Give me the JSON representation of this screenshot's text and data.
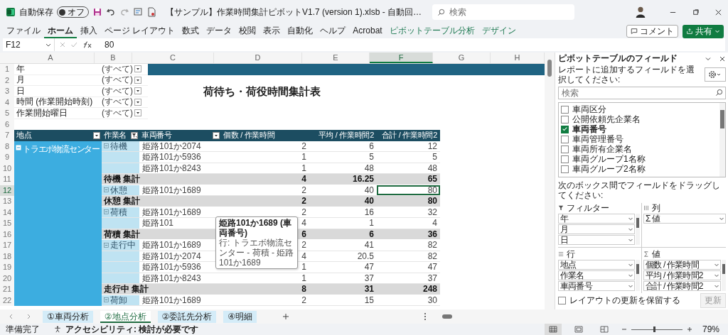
{
  "title_bar": {
    "autosave_label": "自動保存",
    "autosave": {
      "label": "オフ",
      "on": false
    },
    "file_name": "【サンプル】作業時間集計ピボットV1.7 (version 1).xlsb - 自動回…",
    "search": {
      "placeholder": "検索"
    }
  },
  "ribbon_tabs": [
    {
      "label": "ファイル",
      "selected": false,
      "kind": "normal"
    },
    {
      "label": "ホーム",
      "selected": true,
      "kind": "normal"
    },
    {
      "label": "挿入",
      "selected": false,
      "kind": "normal"
    },
    {
      "label": "ページ レイアウト",
      "selected": false,
      "kind": "normal"
    },
    {
      "label": "数式",
      "selected": false,
      "kind": "normal"
    },
    {
      "label": "データ",
      "selected": false,
      "kind": "normal"
    },
    {
      "label": "校閲",
      "selected": false,
      "kind": "normal"
    },
    {
      "label": "表示",
      "selected": false,
      "kind": "normal"
    },
    {
      "label": "自動化",
      "selected": false,
      "kind": "normal"
    },
    {
      "label": "ヘルプ",
      "selected": false,
      "kind": "normal"
    },
    {
      "label": "Acrobat",
      "selected": false,
      "kind": "normal"
    },
    {
      "label": "ピボットテーブル分析",
      "selected": false,
      "kind": "contextual"
    },
    {
      "label": "デザイン",
      "selected": false,
      "kind": "contextual"
    }
  ],
  "ribbon_buttons": {
    "comment": "コメント",
    "share": "共有"
  },
  "formula_bar": {
    "name_box": "F12",
    "value": "80"
  },
  "column_headers": [
    {
      "label": "A",
      "selected": false
    },
    {
      "label": "B",
      "selected": false
    },
    {
      "label": "C",
      "selected": false
    },
    {
      "label": "D",
      "selected": false
    },
    {
      "label": "E",
      "selected": false
    },
    {
      "label": "F",
      "selected": true
    },
    {
      "label": "G",
      "selected": false
    },
    {
      "label": "H",
      "selected": false
    }
  ],
  "row_numbers": [
    {
      "label": "1",
      "selected": false
    },
    {
      "label": "2",
      "selected": false
    },
    {
      "label": "3",
      "selected": false
    },
    {
      "label": "4",
      "selected": false
    },
    {
      "label": "5",
      "selected": false
    },
    {
      "label": "6",
      "selected": false
    },
    {
      "label": "7",
      "selected": false
    },
    {
      "label": "8",
      "selected": false
    },
    {
      "label": "9",
      "selected": false
    },
    {
      "label": "10",
      "selected": false
    },
    {
      "label": "11",
      "selected": false
    },
    {
      "label": "12",
      "selected": true
    },
    {
      "label": "13",
      "selected": false
    },
    {
      "label": "14",
      "selected": false
    },
    {
      "label": "15",
      "selected": false
    },
    {
      "label": "16",
      "selected": false
    },
    {
      "label": "17",
      "selected": false
    },
    {
      "label": "18",
      "selected": false
    },
    {
      "label": "19",
      "selected": false
    },
    {
      "label": "20",
      "selected": false
    },
    {
      "label": "21",
      "selected": false
    },
    {
      "label": "22",
      "selected": false
    }
  ],
  "filters": [
    {
      "label": "年",
      "value": "(すべて)"
    },
    {
      "label": "月",
      "value": "(すべて)"
    },
    {
      "label": "日",
      "value": "(すべて)"
    },
    {
      "label": "時間 (作業開始時刻)",
      "value": "(すべて)"
    },
    {
      "label": "作業開始曜日",
      "value": "(すべて)"
    }
  ],
  "report_title": "荷待ち・荷役時間集計表",
  "pivot": {
    "headers": [
      {
        "label": "地点",
        "kind": "field_dropdown"
      },
      {
        "label": "作業名",
        "kind": "field_filter"
      },
      {
        "label": "車両番号",
        "kind": "field_dropdown"
      },
      {
        "label": "個数 / 作業時間",
        "kind": "value"
      },
      {
        "label": "平均 / 作業時間2",
        "kind": "value"
      },
      {
        "label": "合計 / 作業時間2",
        "kind": "value"
      }
    ],
    "location": "トラエボ物流センター",
    "rows": [
      {
        "kind": "data",
        "task": "待機",
        "vehicle": "姫路101か2074",
        "count": "2",
        "avg": "6",
        "sum": "12",
        "selected": false
      },
      {
        "kind": "data",
        "vehicle": "姫路101か5936",
        "count": "1",
        "avg": "5",
        "sum": "5",
        "selected": false
      },
      {
        "kind": "data",
        "vehicle": "姫路101か8243",
        "count": "1",
        "avg": "48",
        "sum": "48",
        "selected": false
      },
      {
        "kind": "subtotal",
        "label": "待機 集計",
        "count": "4",
        "avg": "16.25",
        "sum": "65",
        "selected": false
      },
      {
        "kind": "data",
        "task": "休憩",
        "vehicle": "姫路101か1689",
        "count": "2",
        "avg": "40",
        "sum": "80",
        "selected": true
      },
      {
        "kind": "subtotal",
        "label": "休憩 集計",
        "count": "2",
        "avg": "40",
        "sum": "80",
        "selected": false
      },
      {
        "kind": "data",
        "task": "荷積",
        "vehicle": "姫路101か1689",
        "count": "2",
        "avg": "16",
        "sum": "32",
        "selected": false
      },
      {
        "kind": "data",
        "vehicle": "姫路101",
        "count": "4",
        "avg": "1",
        "sum": "4",
        "selected": false
      },
      {
        "kind": "subtotal",
        "label": "荷積 集計",
        "count": "6",
        "avg": "6",
        "sum": "36",
        "selected": false
      },
      {
        "kind": "data",
        "task": "走行中",
        "vehicle": "姫路101か1689",
        "count": "2",
        "avg": "41",
        "sum": "82",
        "selected": false
      },
      {
        "kind": "data",
        "vehicle": "姫路101か2074",
        "count": "4",
        "avg": "20.5",
        "sum": "82",
        "selected": false
      },
      {
        "kind": "data",
        "vehicle": "姫路101か5936",
        "count": "1",
        "avg": "47",
        "sum": "47",
        "selected": false
      },
      {
        "kind": "data",
        "vehicle": "姫路101か8243",
        "count": "1",
        "avg": "37",
        "sum": "37",
        "selected": false
      },
      {
        "kind": "subtotal",
        "label": "走行中 集計",
        "count": "8",
        "avg": "31",
        "sum": "248",
        "selected": false
      },
      {
        "kind": "data",
        "task": "荷卸",
        "vehicle": "姫路101か1689",
        "count": "2",
        "avg": "15",
        "sum": "30",
        "selected": false
      }
    ]
  },
  "tooltip": {
    "title": "姫路101か1689 (車両番号)",
    "detail": "行: トラエボ物流センター - 荷積 - 姫路101か1689"
  },
  "sheet_tabs": [
    {
      "label": "①車両分析",
      "selected": false
    },
    {
      "label": "②地点分析",
      "selected": true
    },
    {
      "label": "②委託先分析",
      "selected": false
    },
    {
      "label": "④明細",
      "selected": false
    }
  ],
  "field_panel": {
    "title": "ピボットテーブルのフィールド",
    "subtitle": "レポートに追加するフィールドを選択してください:",
    "search": {
      "placeholder": "検索"
    },
    "fields": [
      {
        "label": "車両区分",
        "checked": false
      },
      {
        "label": "公開依頼先企業名",
        "checked": false
      },
      {
        "label": "車両番号",
        "checked": true
      },
      {
        "label": "車両管理番号",
        "checked": false
      },
      {
        "label": "車両所有企業名",
        "checked": false
      },
      {
        "label": "車両グループ1名称",
        "checked": false
      },
      {
        "label": "車両グループ2名称",
        "checked": false
      }
    ],
    "drag_hint": "次のボックス間でフィールドをドラッグしてください:",
    "areas": [
      {
        "kind": "filter",
        "title": "フィルター",
        "items": [
          "年",
          "月",
          "日"
        ]
      },
      {
        "kind": "columns",
        "title": "列",
        "items": [
          "Σ 値"
        ]
      },
      {
        "kind": "rows",
        "title": "行",
        "items": [
          "地点",
          "作業名",
          "車両番号"
        ]
      },
      {
        "kind": "values",
        "title": "値",
        "items": [
          "個数 / 作業時間",
          "平均 / 作業時間2",
          "合計 / 作業時間2"
        ]
      }
    ],
    "defer": {
      "label": "レイアウトの更新を保留する",
      "checked": false
    },
    "update_button": {
      "label": "更新",
      "disabled": true
    }
  },
  "status_bar": {
    "status": "準備完了",
    "accessibility": "アクセシビリティ: 検討が必要です",
    "views": [
      {
        "kind": "normal",
        "selected": true
      },
      {
        "kind": "page_layout",
        "selected": false
      },
      {
        "kind": "page_break",
        "selected": false
      }
    ],
    "zoom": {
      "level": 0.45,
      "reading": "79%"
    }
  }
}
